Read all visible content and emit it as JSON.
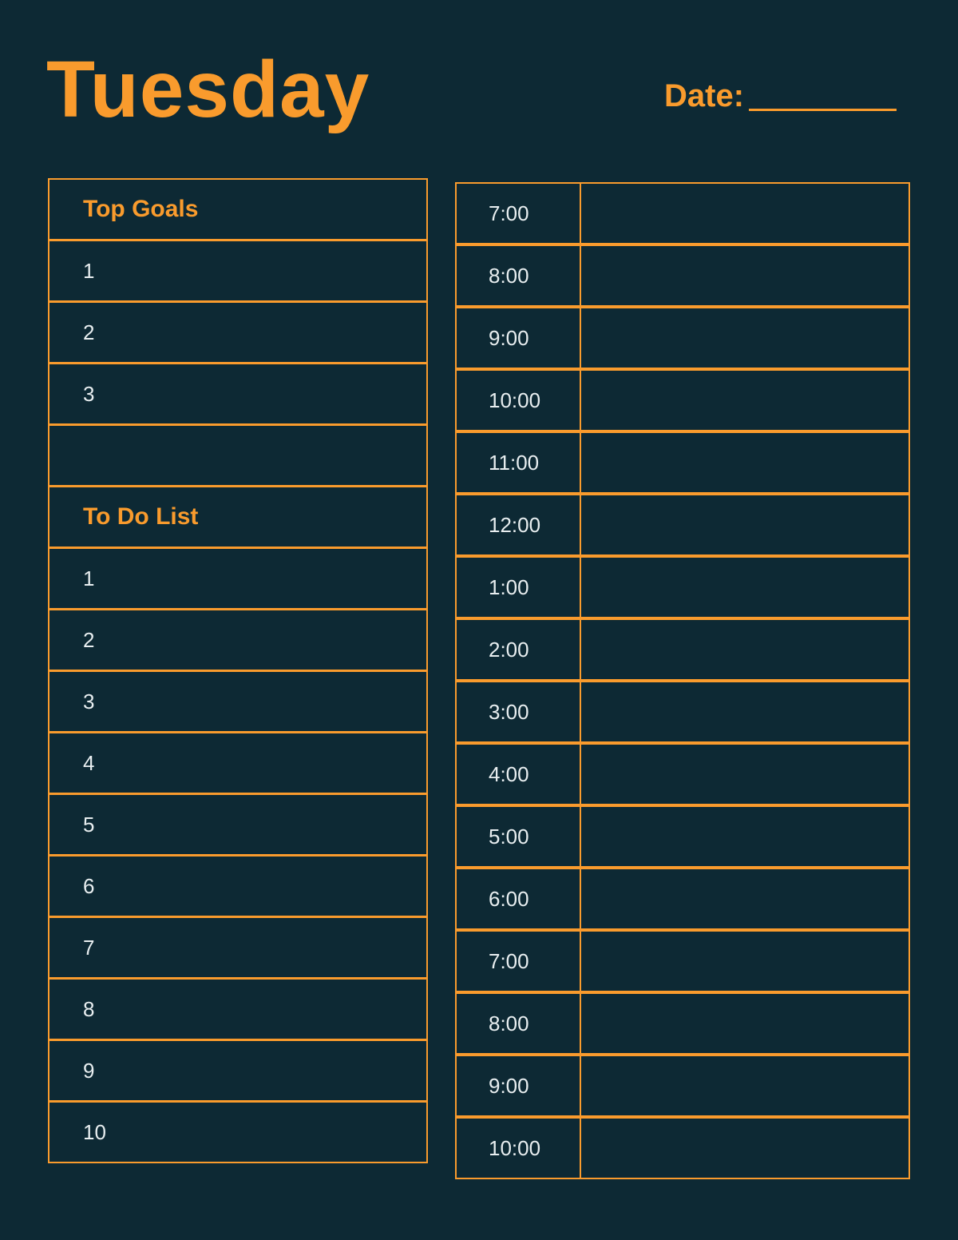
{
  "header": {
    "title": "Tuesday",
    "date_label": "Date:"
  },
  "colors": {
    "background": "#0d2934",
    "accent": "#f99b2d",
    "text": "#e8eef0"
  },
  "top_goals": {
    "heading": "Top Goals",
    "items": [
      "1",
      "2",
      "3",
      ""
    ]
  },
  "todo": {
    "heading": "To Do List",
    "items": [
      "1",
      "2",
      "3",
      "4",
      "5",
      "6",
      "7",
      "8",
      "9",
      "10"
    ]
  },
  "schedule": {
    "times": [
      "7:00",
      "8:00",
      "9:00",
      "10:00",
      "11:00",
      "12:00",
      "1:00",
      "2:00",
      "3:00",
      "4:00",
      "5:00",
      "6:00",
      "7:00",
      "8:00",
      "9:00",
      "10:00"
    ]
  }
}
